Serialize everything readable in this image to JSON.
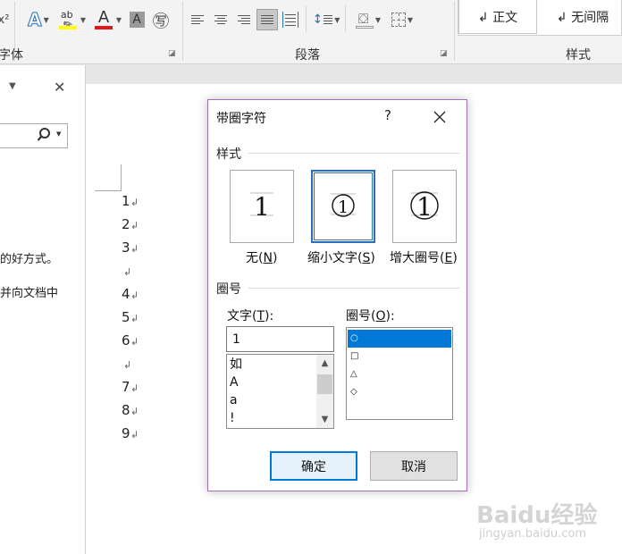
{
  "ribbon": {
    "groups": {
      "font_label": "字体",
      "paragraph_label": "段落",
      "styles_label": "样式"
    },
    "font_color_letter": "A",
    "highlight_text": "ab",
    "superscript_mark": "x²",
    "enclose_char_glyph": "㊢",
    "shading_letter": "A",
    "colors": {
      "font_color": "#e3141b",
      "highlight": "#ffff00",
      "text_effect": "#2e75b6"
    },
    "style_items": [
      {
        "label": "↲ 正文"
      },
      {
        "label": "↲ 无间隔"
      }
    ]
  },
  "nav_pane": {
    "close_glyph": "✕",
    "menu_glyph": "▼",
    "snippets": [
      "的好方式。",
      "并向文档中"
    ]
  },
  "document": {
    "lines": [
      "1",
      "2",
      "3",
      "",
      "4",
      "5",
      "6",
      "",
      "7",
      "8",
      "9"
    ],
    "para_mark": "↲"
  },
  "dialog": {
    "title": "带圈字符",
    "help": "?",
    "style_section": "样式",
    "style_options": [
      {
        "label": "无(",
        "hotkey": "N",
        "suffix": ")",
        "sample": "1",
        "selected": false
      },
      {
        "label": "缩小文字(",
        "hotkey": "S",
        "suffix": ")",
        "sample": "1",
        "selected": true
      },
      {
        "label": "增大圈号(",
        "hotkey": "E",
        "suffix": ")",
        "sample": "1",
        "selected": false
      }
    ],
    "enclosure_section": "圈号",
    "text_label": {
      "label": "文字(",
      "hotkey": "T",
      "suffix": "):"
    },
    "text_value": "1",
    "text_list": [
      "如",
      "A",
      "a",
      "!"
    ],
    "enclosure_label": {
      "label": "圈号(",
      "hotkey": "O",
      "suffix": "):"
    },
    "enclosure_list": [
      {
        "label": "○",
        "selected": true
      },
      {
        "label": "□",
        "selected": false
      },
      {
        "label": "△",
        "selected": false
      },
      {
        "label": "◇",
        "selected": false
      }
    ],
    "ok_label": "确定",
    "cancel_label": "取消"
  },
  "watermark": {
    "brand": "Baidu经验",
    "url": "jingyan.baidu.com"
  }
}
